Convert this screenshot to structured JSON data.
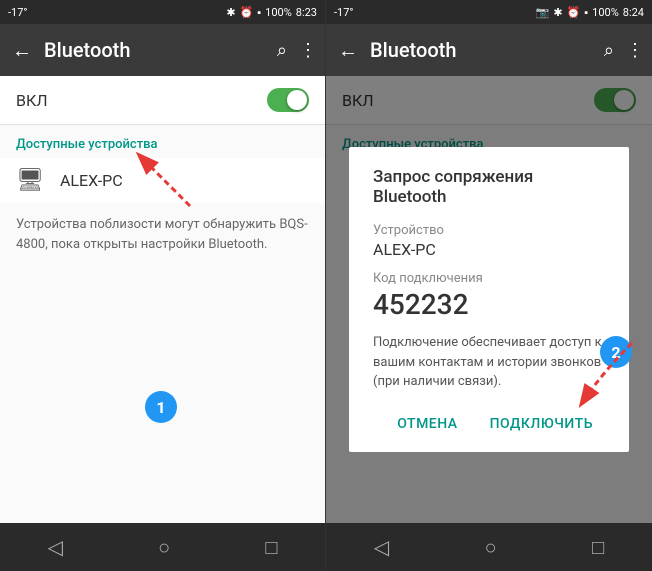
{
  "leftScreen": {
    "statusBar": {
      "temp": "-17°",
      "icons": "bluetooth clock battery",
      "battery": "100%",
      "time": "8:23"
    },
    "toolbar": {
      "title": "Bluetooth",
      "backArrow": "←",
      "searchIcon": "⌕",
      "moreIcon": "⋮"
    },
    "toggleRow": {
      "label": "ВКЛ"
    },
    "sectionHeader": "Доступные устройства",
    "deviceName": "ALEX-PC",
    "discoveryText": "Устройства поблизости могут обнаружить BQS-4800, пока открыты настройки Bluetooth.",
    "stepLabel": "1",
    "navBar": {
      "back": "◁",
      "home": "○",
      "recent": "□"
    }
  },
  "rightScreen": {
    "statusBar": {
      "temp": "-17°",
      "icons": "camera bluetooth clock battery",
      "battery": "100%",
      "time": "8:24"
    },
    "toolbar": {
      "title": "Bluetooth",
      "backArrow": "←",
      "searchIcon": "⌕",
      "moreIcon": "⋮"
    },
    "toggleRow": {
      "label": "ВКЛ"
    },
    "sectionHeader": "Доступные устройства",
    "dialog": {
      "title": "Запрос сопряжения Bluetooth",
      "deviceLabel": "Устройство",
      "deviceName": "ALEX-PC",
      "codeLabel": "Код подключения",
      "code": "452232",
      "description": "Подключение обеспечивает доступ к вашим контактам и истории звонков (при наличии связи).",
      "cancelButton": "ОТМЕНА",
      "connectButton": "ПОДКЛЮЧИТЬ"
    },
    "stepLabel": "2",
    "navBar": {
      "back": "◁",
      "home": "○",
      "recent": "□"
    }
  }
}
